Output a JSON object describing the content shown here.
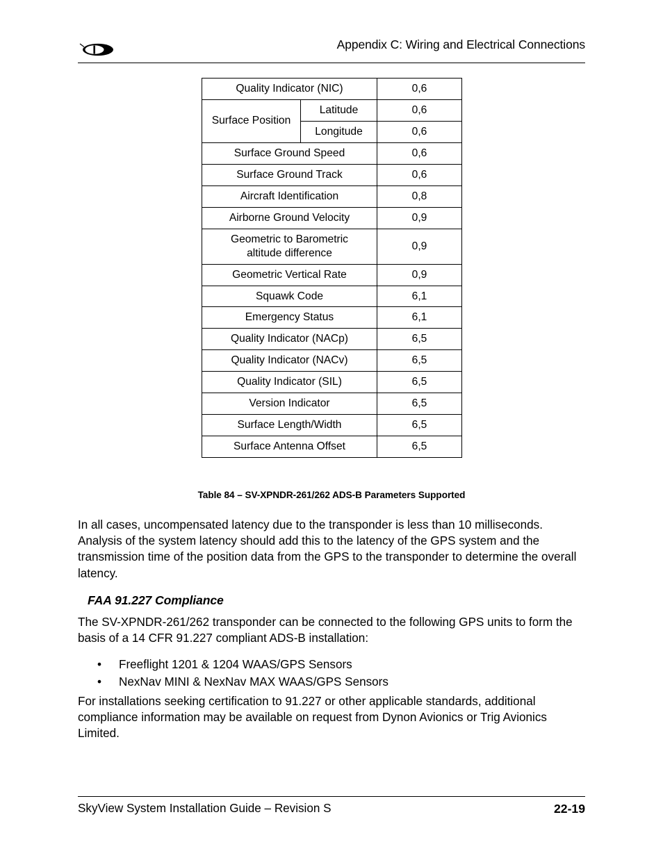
{
  "header": {
    "logo_icon": "dynon-logo-icon",
    "title": "Appendix C: Wiring and Electrical Connections"
  },
  "table": {
    "caption": "Table 84 – SV-XPNDR-261/262 ADS-B Parameters Supported",
    "rows": [
      {
        "name": "Quality Indicator (NIC)",
        "sub": null,
        "value": "0,6"
      },
      {
        "name": "Surface Position",
        "sub": "Latitude",
        "value": "0,6"
      },
      {
        "name": "Surface Position",
        "sub": "Longitude",
        "value": "0,6"
      },
      {
        "name": "Surface Ground Speed",
        "sub": null,
        "value": "0,6"
      },
      {
        "name": "Surface Ground Track",
        "sub": null,
        "value": "0,6"
      },
      {
        "name": "Aircraft Identification",
        "sub": null,
        "value": "0,8"
      },
      {
        "name": "Airborne Ground Velocity",
        "sub": null,
        "value": "0,9"
      },
      {
        "name": "Geometric to Barometric altitude difference",
        "name_line1": "Geometric to Barometric",
        "name_line2": "altitude difference",
        "sub": null,
        "value": "0,9"
      },
      {
        "name": "Geometric Vertical Rate",
        "sub": null,
        "value": "0,9"
      },
      {
        "name": "Squawk Code",
        "sub": null,
        "value": "6,1"
      },
      {
        "name": "Emergency Status",
        "sub": null,
        "value": "6,1"
      },
      {
        "name": "Quality Indicator (NACp)",
        "sub": null,
        "value": "6,5"
      },
      {
        "name": "Quality Indicator (NACv)",
        "sub": null,
        "value": "6,5"
      },
      {
        "name": "Quality Indicator (SIL)",
        "sub": null,
        "value": "6,5"
      },
      {
        "name": "Version Indicator",
        "sub": null,
        "value": "6,5"
      },
      {
        "name": "Surface Length/Width",
        "sub": null,
        "value": "6,5"
      },
      {
        "name": "Surface Antenna Offset",
        "sub": null,
        "value": "6,5"
      }
    ]
  },
  "content": {
    "para_latency": "In all cases, uncompensated latency due to the transponder is less than 10 milliseconds. Analysis of the system latency should add this to the latency of the GPS system and the transmission time of the position data from the GPS to the transponder to determine the overall latency.",
    "heading_compliance": "FAA 91.227 Compliance",
    "para_intro": "The SV-XPNDR-261/262 transponder can be connected to the following GPS units to form the basis of a 14 CFR 91.227 compliant ADS-B installation:",
    "bullets": [
      "Freeflight 1201 & 1204 WAAS/GPS Sensors",
      "NexNav MINI & NexNav MAX WAAS/GPS Sensors"
    ],
    "bullet_glyph": "•",
    "para_closing": "For installations seeking certification to 91.227 or other applicable standards, additional compliance information may be available on request from Dynon Avionics or Trig Avionics Limited."
  },
  "footer": {
    "document_title": "SkyView System Installation Guide – Revision S",
    "page_number": "22-19"
  }
}
